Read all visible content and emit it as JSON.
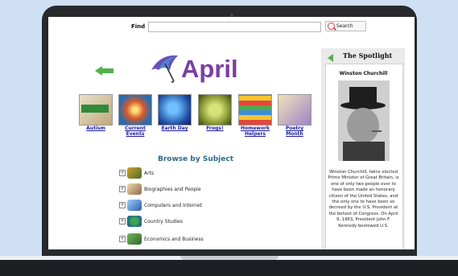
{
  "colors": {
    "accent": "#7a3ea1",
    "link": "#1a1aa5",
    "arrow": "#53b04c",
    "heading": "#2a6b8a"
  },
  "search": {
    "label": "Find",
    "value": "",
    "button": "Search"
  },
  "header": {
    "title": "April"
  },
  "thumbnails": [
    {
      "label": "Autism",
      "icon": "autism-thumb"
    },
    {
      "label": "Current Events",
      "icon": "globe-thumb"
    },
    {
      "label": "Earth Day",
      "icon": "earth-thumb"
    },
    {
      "label": "Frogs!",
      "icon": "frog-thumb"
    },
    {
      "label": "Homework Helpers",
      "icon": "books-thumb"
    },
    {
      "label": "Poetry Month",
      "icon": "stamp-thumb"
    }
  ],
  "browse": {
    "title": "Browse by Subject",
    "items": [
      {
        "label": "Arts",
        "icon": "arts-icon"
      },
      {
        "label": "Biographies and People",
        "icon": "people-icon"
      },
      {
        "label": "Computers and Internet",
        "icon": "computer-icon"
      },
      {
        "label": "Country Studies",
        "icon": "globe-icon"
      },
      {
        "label": "Economics and Business",
        "icon": "money-icon"
      }
    ]
  },
  "spotlight": {
    "title": "The Spotlight",
    "name": "Winston Churchill",
    "text": "Winston Churchill, twice elected Prime Minister of Great Britain, is one of only two people ever to have been made an honorary citizen of the United States, and the only one to have been so decreed by the U.S. President at the behest of Congress. On April 9, 1963, President John F. Kennedy bestowed U.S."
  }
}
